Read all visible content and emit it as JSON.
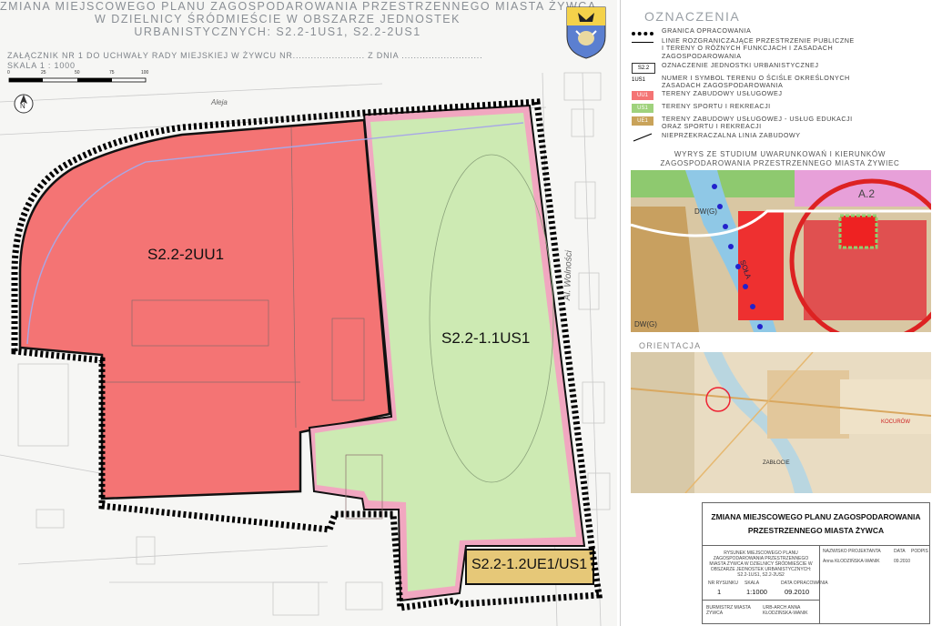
{
  "header": {
    "title_lines": [
      "ZMIANA MIEJSCOWEGO PLANU ZAGOSPODAROWANIA PRZESTRZENNEGO MIASTA ŻYWCA",
      "W DZIELNICY ŚRÓDMIEŚCIE W OBSZARZE JEDNOSTEK",
      "URBANISTYCZNYCH: S2.2-1US1, S2.2-2US1"
    ],
    "attachment": "ZAŁĄCZNIK NR 1 DO UCHWAŁY RADY MIEJSKIEJ W ŻYWCU NR........................  Z DNIA ...........................",
    "scale": "SKALA 1 : 1000",
    "scalebar_ticks": [
      "0",
      "25",
      "50",
      "75",
      "100"
    ]
  },
  "map": {
    "zones": [
      {
        "label": "S2.2-2UU1"
      },
      {
        "label": "S2.2-1.1US1"
      },
      {
        "label": "S2.2-1.2UE1/US1"
      }
    ],
    "streets": [
      "Al. Wolności",
      "Aleja"
    ],
    "colors": {
      "services": "#f47474",
      "sport": "#cdeab3",
      "border_pink": "#f1a7c0",
      "road": "#b8b8e8"
    }
  },
  "legend": {
    "title": "OZNACZENIA",
    "items": [
      {
        "symbol": "dashed-black",
        "text": "GRANICA OPRACOWANIA"
      },
      {
        "symbol": "line",
        "text": "LINIE ROZGRANICZAJĄCE PRZESTRZENIE PUBLICZNE\nI TERENY O RÓŻNYCH FUNKCJACH I ZASADACH\nZAGOSPODAROWANIA"
      },
      {
        "symbol": "box",
        "code": "S2.2",
        "text": "OZNACZENIE JEDNOSTKI URBANISTYCZNEJ"
      },
      {
        "symbol": "box-small",
        "code": "1US1",
        "text": "NUMER I SYMBOL TERENU O ŚCIŚLE OKREŚLONYCH\nZASADACH ZAGOSPODAROWANIA"
      },
      {
        "symbol": "fill-red",
        "code": "UU1",
        "text": "TERENY ZABUDOWY USŁUGOWEJ"
      },
      {
        "symbol": "fill-green",
        "code": "US1",
        "text": "TERENY SPORTU I REKREACJI"
      },
      {
        "symbol": "fill-olive",
        "code": "UE1",
        "text": "TERENY ZABUDOWY USŁUGOWEJ - USŁUG EDUKACJI\nORAZ SPORTU I REKREACJI"
      },
      {
        "symbol": "diag-line",
        "text": "NIEPRZEKRACZALNA LINIA ZABUDOWY"
      }
    ]
  },
  "study_title": "WYRYS ZE STUDIUM UWARUNKOWAŃ I KIERUNKÓW\nZAGOSPODAROWANIA PRZESTRZENNEGO MIASTA ŻYWIEC",
  "study_labels": [
    "DW(G)",
    "SOŁA",
    "A.2",
    "DW(G)"
  ],
  "orientation_title": "ORIENTACJA",
  "orientation_labels": [
    "KOCURÓW",
    "ZABŁOCIE"
  ],
  "title_block": {
    "title_lines": [
      "ZMIANA MIEJSCOWEGO PLANU ZAGOSPODAROWANIA",
      "PRZESTRZENNEGO MIASTA ŻYWCA"
    ],
    "drawing_desc": "RYSUNEK MIEJSCOWEGO PLANU ZAGOSPODAROWANIA PRZESTRZENNEGO MIASTA ŻYWCA W DZIELNICY ŚRÓDMIEŚCIE W OBSZARZE JEDNOSTEK URBANISTYCZNYCH: S2.2-1US1, S2.2-2US2",
    "col_headers": [
      "NAZWISKO PROJEKTANTA",
      "DATA",
      "PODPIS"
    ],
    "designer": "Anna KŁODZIŃSKA-WANIK",
    "designer_date": "09.2010",
    "small_headers": [
      "NR RYSUNKU",
      "SKALA",
      "DATA OPRACOWANIA"
    ],
    "drawing_no": "1",
    "scale": "1:1000",
    "date": "09.2010",
    "client": "BURMISTRZ MIASTA ŻYWCA",
    "contractor": "URB-ARCH ANNA KŁODZIŃSKA-WANIK"
  }
}
